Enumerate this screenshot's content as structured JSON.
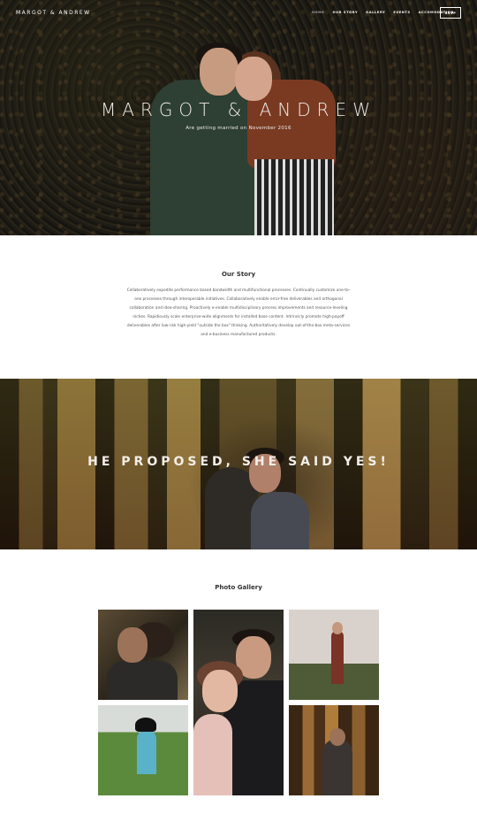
{
  "nav": {
    "brand": "MARGOT & ANDREW",
    "items": [
      "HOME",
      "OUR STORY",
      "GALLERY",
      "EVENTS",
      "ACCOMODATION"
    ],
    "active_item": "HOME",
    "rsvp_label": "RSVP"
  },
  "hero": {
    "title": "MARGOT & ANDREW",
    "subtitle": "Are getting married on November 2016"
  },
  "story": {
    "title": "Our Story",
    "text": "Collaboratively expedite performance based bandwidth and multifunctional processes. Continually customize one-to-one processes through interoperable initiatives. Collaboratively enable error-free deliverables and orthogonal collaboration and idea-sharing. Proactively e-enable multidisciplinary process improvements and resource-leveling niches. Rapidiously scale enterprise-wide alignments for installed base content. Intrinsicly promote high-payoff deliverables after low-risk high-yield \"outside the box\" thinking. Authoritatively develop out-of-the-box meta-services and e-business manufactured products."
  },
  "proposal": {
    "title": "HE PROPOSED, SHE SAID YES!"
  },
  "gallery": {
    "title": "Photo Gallery"
  }
}
